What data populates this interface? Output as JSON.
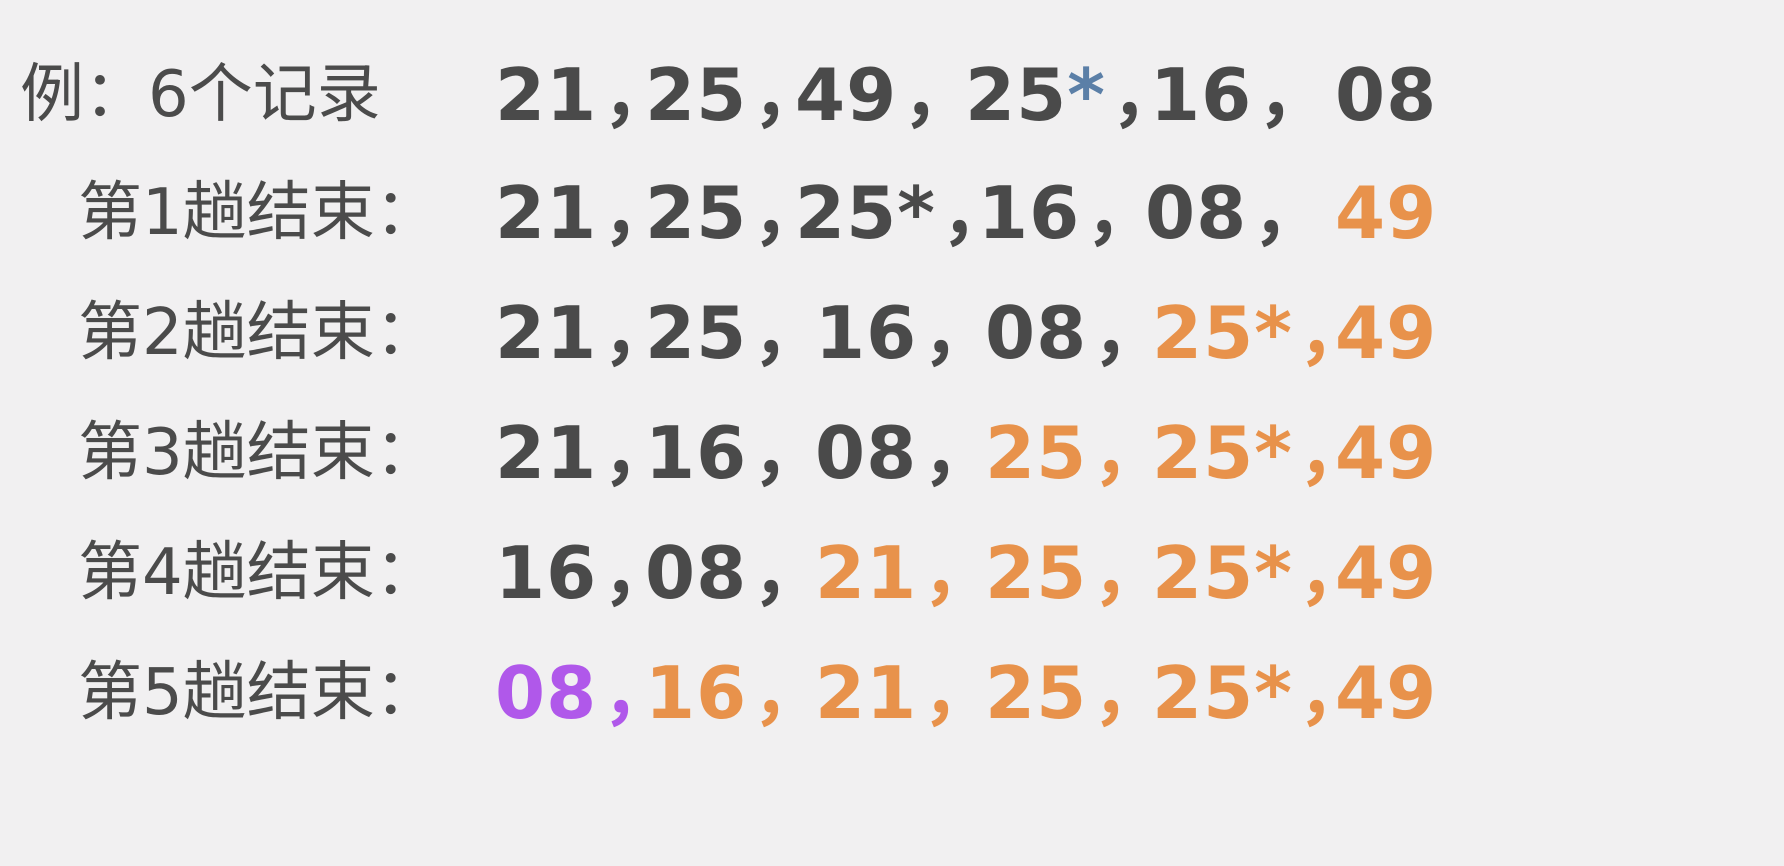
{
  "colors": {
    "background": "#f1f0f1",
    "text_gray": "#4a4a4a",
    "label_gray": "#4b4b4b",
    "sorted_orange": "#e8924b",
    "final_purple": "#b058ea",
    "star_blue": "#5b7fa7"
  },
  "example": {
    "label": "例：6个记录",
    "values": [
      "21",
      "25",
      "49",
      "25",
      "16",
      "08"
    ],
    "star": "*"
  },
  "passes": [
    {
      "label": "第1趟结束：",
      "values": [
        "21",
        "25",
        "25*",
        "16",
        "08",
        "49"
      ]
    },
    {
      "label": "第2趟结束：",
      "values": [
        "21",
        "25",
        "16",
        "08",
        "25*",
        "49"
      ]
    },
    {
      "label": "第3趟结束：",
      "values": [
        "21",
        "16",
        "08",
        "25",
        "25*",
        "49"
      ]
    },
    {
      "label": "第4趟结束：",
      "values": [
        "16",
        "08",
        "21",
        "25",
        "25*",
        "49"
      ]
    },
    {
      "label": "第5趟结束：",
      "values": [
        "08",
        "16",
        "21",
        "25",
        "25*",
        "49"
      ]
    }
  ],
  "separator": "，"
}
